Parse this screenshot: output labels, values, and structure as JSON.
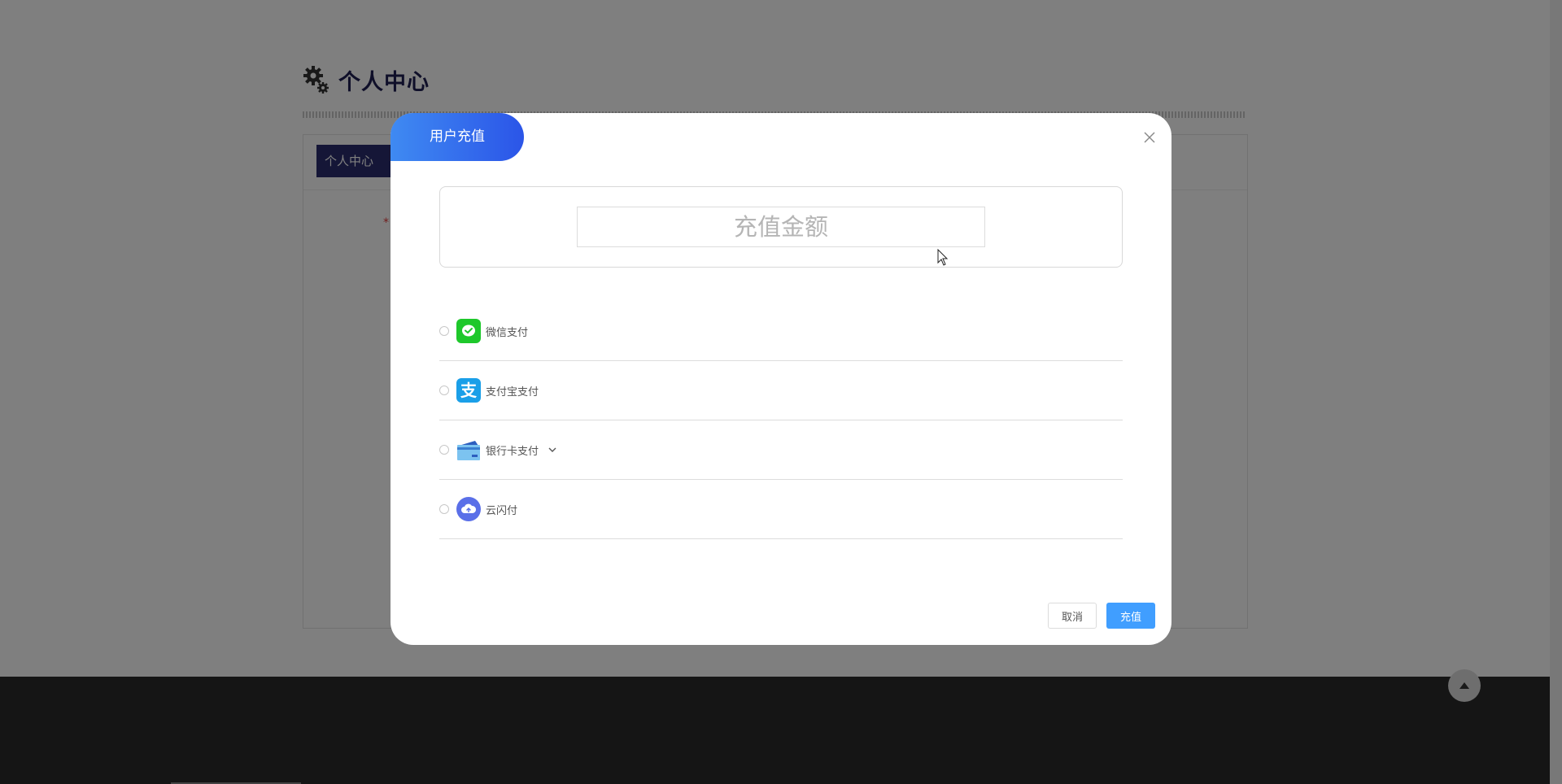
{
  "page": {
    "header_title": "个人中心",
    "tab_label": "个人中心",
    "required_mark": "*"
  },
  "modal": {
    "title": "用户充值",
    "amount_placeholder": "充值金额",
    "payment_methods": [
      {
        "label": "微信支付",
        "icon": "wechat-pay-icon",
        "color": "#1ec82b"
      },
      {
        "label": "支付宝支付",
        "icon": "alipay-icon",
        "color": "#1a9fe8"
      },
      {
        "label": "银行卡支付",
        "icon": "bank-card-icon",
        "color": "#3a7fd0",
        "has_dropdown": true
      },
      {
        "label": "云闪付",
        "icon": "unionpay-cloud-icon",
        "color": "#5a6fe8"
      }
    ],
    "buttons": {
      "cancel": "取消",
      "recharge": "充值"
    }
  },
  "colors": {
    "accent": "#409eff",
    "tag_gradient_start": "#3f8af2",
    "tag_gradient_end": "#2b55e8",
    "header_text": "#1e1e52",
    "tab_bg": "#2a2d6e",
    "footer": "#2a2a2a"
  }
}
